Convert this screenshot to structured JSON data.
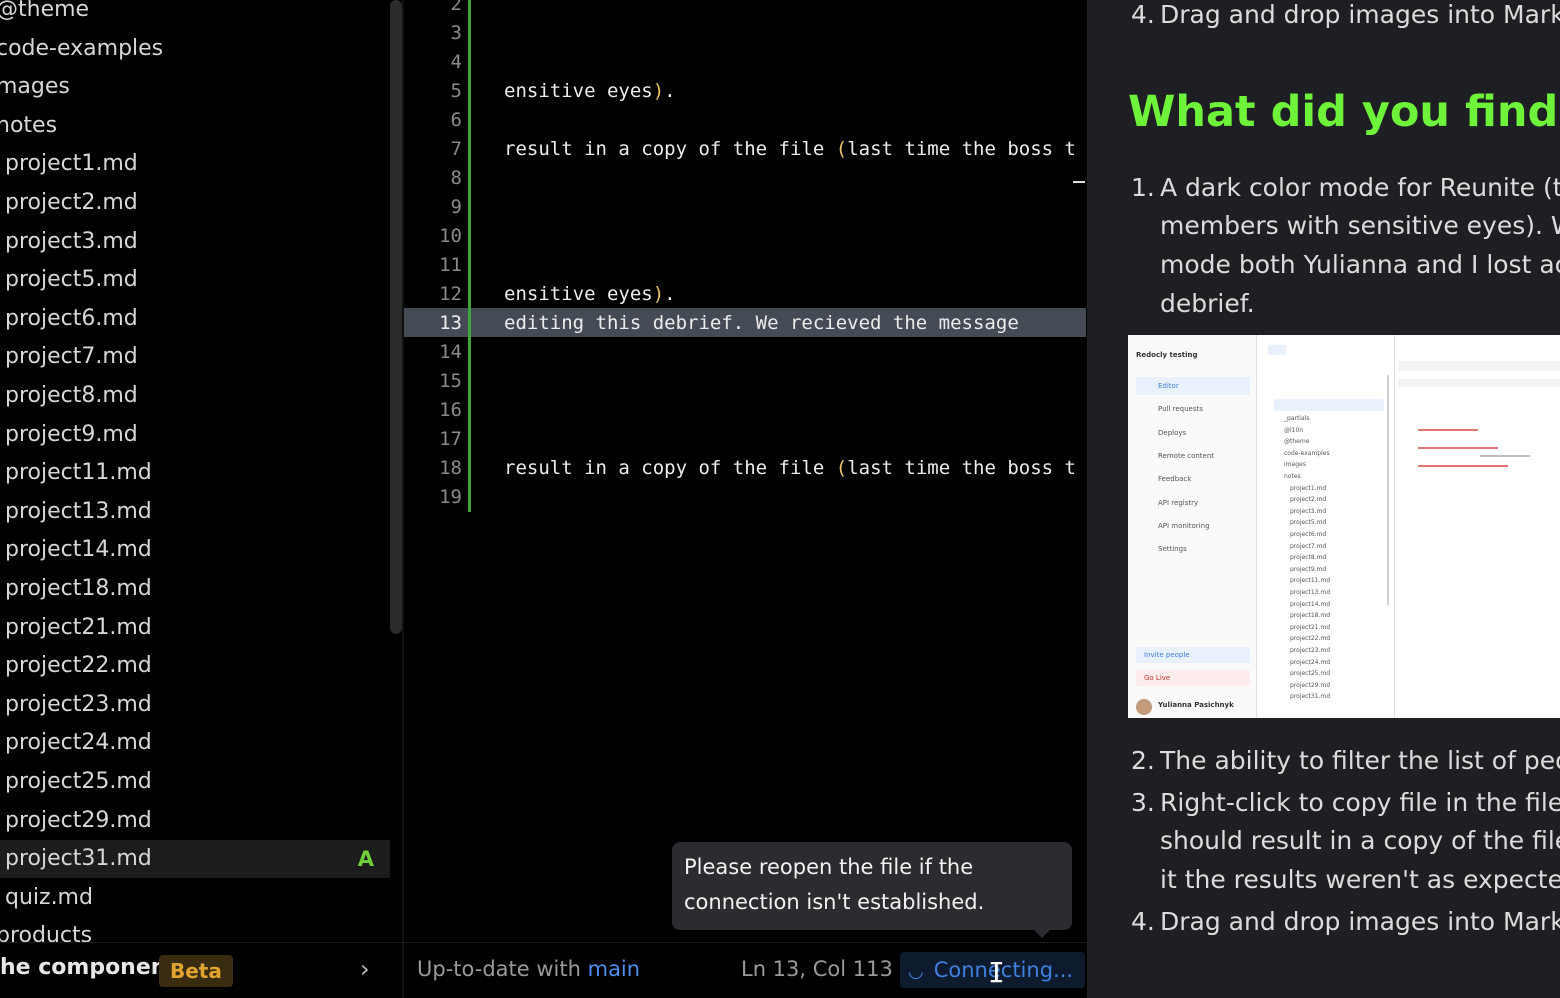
{
  "sidebar": {
    "items": [
      {
        "label": "@theme",
        "indent": 0
      },
      {
        "label": "code-examples",
        "indent": 0
      },
      {
        "label": "mages",
        "indent": 0
      },
      {
        "label": "notes",
        "indent": 0
      },
      {
        "label": "project1.md",
        "indent": 1
      },
      {
        "label": "project2.md",
        "indent": 1
      },
      {
        "label": "project3.md",
        "indent": 1
      },
      {
        "label": "project5.md",
        "indent": 1
      },
      {
        "label": "project6.md",
        "indent": 1
      },
      {
        "label": "project7.md",
        "indent": 1
      },
      {
        "label": "project8.md",
        "indent": 1
      },
      {
        "label": "project9.md",
        "indent": 1
      },
      {
        "label": "project11.md",
        "indent": 1
      },
      {
        "label": "project13.md",
        "indent": 1
      },
      {
        "label": "project14.md",
        "indent": 1
      },
      {
        "label": "project18.md",
        "indent": 1
      },
      {
        "label": "project21.md",
        "indent": 1
      },
      {
        "label": "project22.md",
        "indent": 1
      },
      {
        "label": "project23.md",
        "indent": 1
      },
      {
        "label": "project24.md",
        "indent": 1
      },
      {
        "label": "project25.md",
        "indent": 1
      },
      {
        "label": "project29.md",
        "indent": 1
      },
      {
        "label": "project31.md",
        "indent": 1,
        "selected": true,
        "badge": "A"
      },
      {
        "label": "quiz.md",
        "indent": 1
      },
      {
        "label": "products",
        "indent": 0
      }
    ],
    "footer": {
      "label": "he components",
      "beta": "Beta",
      "chevron": "›"
    }
  },
  "editor": {
    "lines": [
      {
        "num": "2",
        "text": ""
      },
      {
        "num": "3",
        "text": ""
      },
      {
        "num": "4",
        "text": ""
      },
      {
        "num": "5",
        "text": "ensitive eyes",
        "close_paren": ")",
        "tail": "."
      },
      {
        "num": "6",
        "text": ""
      },
      {
        "num": "7",
        "text": "result in a copy of the file ",
        "open_paren": "(",
        "tail": "last time the boss t"
      },
      {
        "num": "8",
        "text": ""
      },
      {
        "num": "9",
        "text": ""
      },
      {
        "num": "10",
        "text": ""
      },
      {
        "num": "11",
        "text": ""
      },
      {
        "num": "12",
        "text": "ensitive eyes",
        "close_paren": ")",
        "tail": "."
      },
      {
        "num": "13",
        "text": "editing this debrief. We recieved the message",
        "current": true
      },
      {
        "num": "14",
        "text": ""
      },
      {
        "num": "15",
        "text": ""
      },
      {
        "num": "16",
        "text": ""
      },
      {
        "num": "17",
        "text": ""
      },
      {
        "num": "18",
        "text": "result in a copy of the file ",
        "open_paren": "(",
        "tail": "last time the boss t"
      },
      {
        "num": "19",
        "text": ""
      }
    ],
    "tooltip": "Please reopen the file if the connection isn't established.",
    "status": {
      "sync_text": "Up-to-date with",
      "branch": "main",
      "position": "Ln 13, Col 113",
      "connection": "Connecting...",
      "spinner_icon": "◡"
    }
  },
  "preview": {
    "top_item": {
      "num": "4.",
      "text": "Drag and drop images into Markdo"
    },
    "heading": "What did you find cor",
    "item1": {
      "num": "1.",
      "lines": [
        "A dark color mode for Reunite (the",
        "members with sensitive eyes). Wh",
        "mode both Yulianna and I lost acce",
        "debrief."
      ]
    },
    "item2": {
      "num": "2.",
      "text": "The ability to filter the list of peopl"
    },
    "item3": {
      "num": "3.",
      "lines": [
        "Right-click to copy file in the filetre",
        "should result in a copy of the file (l",
        "it the results weren't as expected)."
      ]
    },
    "item4": {
      "num": "4.",
      "text": "Drag and drop images into Markdo"
    },
    "screenshot": {
      "org": "Redocly testing",
      "nav": [
        "Editor",
        "Pull requests",
        "Deploys",
        "Remote content",
        "Feedback",
        "API registry",
        "API monitoring",
        "Settings"
      ],
      "files": [
        "_partials",
        "@l10n",
        "@theme",
        "code-examples",
        "images",
        "notes",
        "project1.md",
        "project2.md",
        "project3.md",
        "project5.md",
        "project6.md",
        "project7.md",
        "project8.md",
        "project9.md",
        "project11.md",
        "project13.md",
        "project14.md",
        "project18.md",
        "project21.md",
        "project22.md",
        "project23.md",
        "project24.md",
        "project25.md",
        "project29.md",
        "project31.md"
      ],
      "buttons": [
        "Invite people",
        "Go Live"
      ],
      "user": "Yulianna Pasichnyk"
    }
  },
  "colors": {
    "accent_green": "#6ff23a",
    "gutter_green": "#3da33b",
    "branch_blue": "#4d8ef0",
    "beta_orange": "#e0a530"
  }
}
